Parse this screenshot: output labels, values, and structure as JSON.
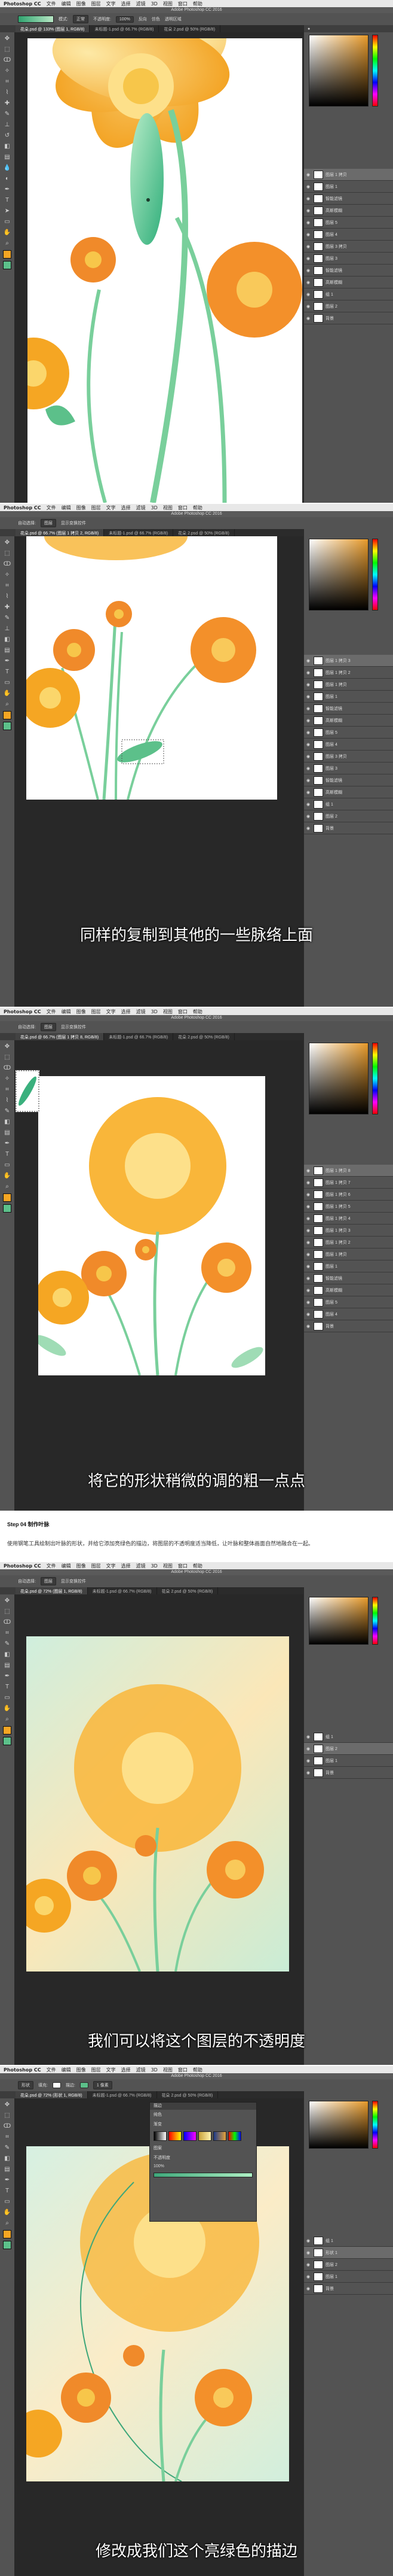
{
  "menu": {
    "app": "Photoshop CC",
    "items": [
      "文件",
      "编辑",
      "图像",
      "图层",
      "文字",
      "选择",
      "滤镜",
      "3D",
      "视图",
      "窗口",
      "帮助"
    ]
  },
  "window_title": "Adobe Photoshop CC 2016",
  "shots": [
    {
      "tabs": [
        "花朵.psd @ 133% (图层 1, RGB/8)",
        "未标题-1.psd @ 66.7% (RGB/8)",
        "花朵 2.psd @ 50% (RGB/8)"
      ],
      "options": [
        "模式:",
        "正常",
        "不透明度:",
        "100%",
        "反向",
        "仿色",
        "透明区域"
      ],
      "caption": "",
      "layers": [
        "图层 1 拷贝",
        "图层 1",
        "智能滤镜",
        "高斯模糊",
        "图层 5",
        "图层 4",
        "图层 3 拷贝",
        "图层 3",
        "智能滤镜",
        "高斯模糊",
        "组 1",
        "图层 2",
        "背景"
      ]
    },
    {
      "tabs": [
        "花朵.psd @ 66.7% (图层 1 拷贝 2, RGB/8)",
        "未标题-1.psd @ 66.7% (RGB/8)",
        "花朵 2.psd @ 50% (RGB/8)"
      ],
      "options": [
        "自动选择:",
        "图层",
        "显示变换控件"
      ],
      "caption": "同样的复制到其他的一些脉络上面",
      "layers": [
        "图层 1 拷贝 3",
        "图层 1 拷贝 2",
        "图层 1 拷贝",
        "图层 1",
        "智能滤镜",
        "高斯模糊",
        "图层 5",
        "图层 4",
        "图层 3 拷贝",
        "图层 3",
        "智能滤镜",
        "高斯模糊",
        "组 1",
        "图层 2",
        "背景"
      ]
    },
    {
      "tabs": [
        "花朵.psd @ 66.7% (图层 1 拷贝 8, RGB/8)",
        "未标题-1.psd @ 66.7% (RGB/8)",
        "花朵 2.psd @ 50% (RGB/8)"
      ],
      "options": [
        "自动选择:",
        "图层",
        "显示变换控件"
      ],
      "caption": "将它的形状稍微的调的粗一点点",
      "layers": [
        "图层 1 拷贝 8",
        "图层 1 拷贝 7",
        "图层 1 拷贝 6",
        "图层 1 拷贝 5",
        "图层 1 拷贝 4",
        "图层 1 拷贝 3",
        "图层 1 拷贝 2",
        "图层 1 拷贝",
        "图层 1",
        "智能滤镜",
        "高斯模糊",
        "图层 5",
        "图层 4",
        "背景"
      ]
    },
    {
      "tabs": [
        "花朵.psd @ 72% (图层 1, RGB/8)",
        "未标题-1.psd @ 66.7% (RGB/8)",
        "花朵 2.psd @ 50% (RGB/8)"
      ],
      "options": [
        "自动选择:",
        "图层",
        "显示变换控件"
      ],
      "caption": "我们可以将这个图层的不透明度",
      "layers": [
        "组 1",
        "图层 2",
        "图层 1",
        "背景"
      ]
    },
    {
      "tabs": [
        "花朵.psd @ 72% (形状 1, RGB/8)",
        "未标题-1.psd @ 66.7% (RGB/8)",
        "花朵 2.psd @ 50% (RGB/8)"
      ],
      "options": [
        "形状",
        "填充:",
        "描边:",
        "1 像素"
      ],
      "caption": "修改成我们这个亮绿色的描边",
      "dialog": {
        "title": "描边",
        "rows": [
          "纯色",
          "渐变",
          "图案",
          "不透明度",
          "100%"
        ]
      },
      "layers": [
        "组 1",
        "形状 1",
        "图层 2",
        "图层 1",
        "背景"
      ]
    }
  ],
  "between": {
    "step": "Step 04 制作叶脉",
    "text": "使用钢笔工具绘制出叶脉的形状，并给它添加亮绿色的描边，将图层的不透明度适当降低，让叶脉和整体画面自然地融合在一起。"
  },
  "colors": {
    "panel": "#535353",
    "canvas_bg": "#282828",
    "orange": "#f5a623",
    "green": "#5cc08a"
  }
}
